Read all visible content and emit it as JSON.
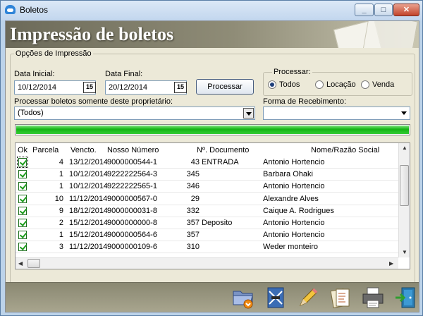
{
  "window": {
    "title": "Boletos"
  },
  "banner": {
    "title": "Impressão de boletos"
  },
  "options": {
    "legend": "Opções de Impressão",
    "data_inicial_label": "Data Inicial:",
    "data_inicial": "10/12/2014",
    "data_final_label": "Data Final:",
    "data_final": "20/12/2014",
    "calendar_glyph": "15",
    "processar_button": "Processar",
    "proprietario_label": "Processar boletos somente deste proprietário:",
    "proprietario_value": "(Todos)",
    "forma_label": "Forma de Recebimento:",
    "forma_value": ""
  },
  "processar": {
    "legend": "Processar:",
    "options": [
      {
        "label": "Todos",
        "checked": true
      },
      {
        "label": "Locação",
        "checked": false
      },
      {
        "label": "Venda",
        "checked": false
      }
    ]
  },
  "progress": {
    "percent": 100,
    "color": "#13b413"
  },
  "grid": {
    "headers": {
      "ok": "Ok",
      "parcela": "Parcela",
      "vencto": "Vencto.",
      "nosso": "Nosso Número",
      "documento": "Nº. Documento",
      "nome": "Nome/Razão Social"
    },
    "rows": [
      {
        "checked": true,
        "parcela": "4",
        "vencto": "13/12/2014",
        "nosso": "9000000544-1",
        "doc": "43",
        "extra": "ENTRADA",
        "nome": "Antonio Hortencio"
      },
      {
        "checked": true,
        "parcela": "1",
        "vencto": "10/12/2014",
        "nosso": "9222222564-3",
        "doc": "345",
        "extra": "",
        "nome": "Barbara Ohaki"
      },
      {
        "checked": true,
        "parcela": "1",
        "vencto": "10/12/2014",
        "nosso": "9222222565-1",
        "doc": "346",
        "extra": "",
        "nome": "Antonio Hortencio"
      },
      {
        "checked": true,
        "parcela": "10",
        "vencto": "11/12/2014",
        "nosso": "9000000567-0",
        "doc": "29",
        "extra": "",
        "nome": "Alexandre Alves"
      },
      {
        "checked": true,
        "parcela": "9",
        "vencto": "18/12/2014",
        "nosso": "9000000031-8",
        "doc": "332",
        "extra": "",
        "nome": "Caique A. Rodrigues"
      },
      {
        "checked": true,
        "parcela": "2",
        "vencto": "15/12/2014",
        "nosso": "9000000000-8",
        "doc": "357",
        "extra": "Deposito",
        "nome": "Antonio Hortencio"
      },
      {
        "checked": true,
        "parcela": "1",
        "vencto": "15/12/2014",
        "nosso": "9000000564-6",
        "doc": "357",
        "extra": "",
        "nome": "Antonio Hortencio"
      },
      {
        "checked": true,
        "parcela": "3",
        "vencto": "11/12/2014",
        "nosso": "9000000109-6",
        "doc": "310",
        "extra": "",
        "nome": "Weder monteiro"
      }
    ]
  },
  "toolbar": {
    "icons": [
      "open-folder-icon",
      "mail-icon",
      "pencil-icon",
      "report-icon",
      "printer-icon",
      "exit-door-icon"
    ]
  }
}
